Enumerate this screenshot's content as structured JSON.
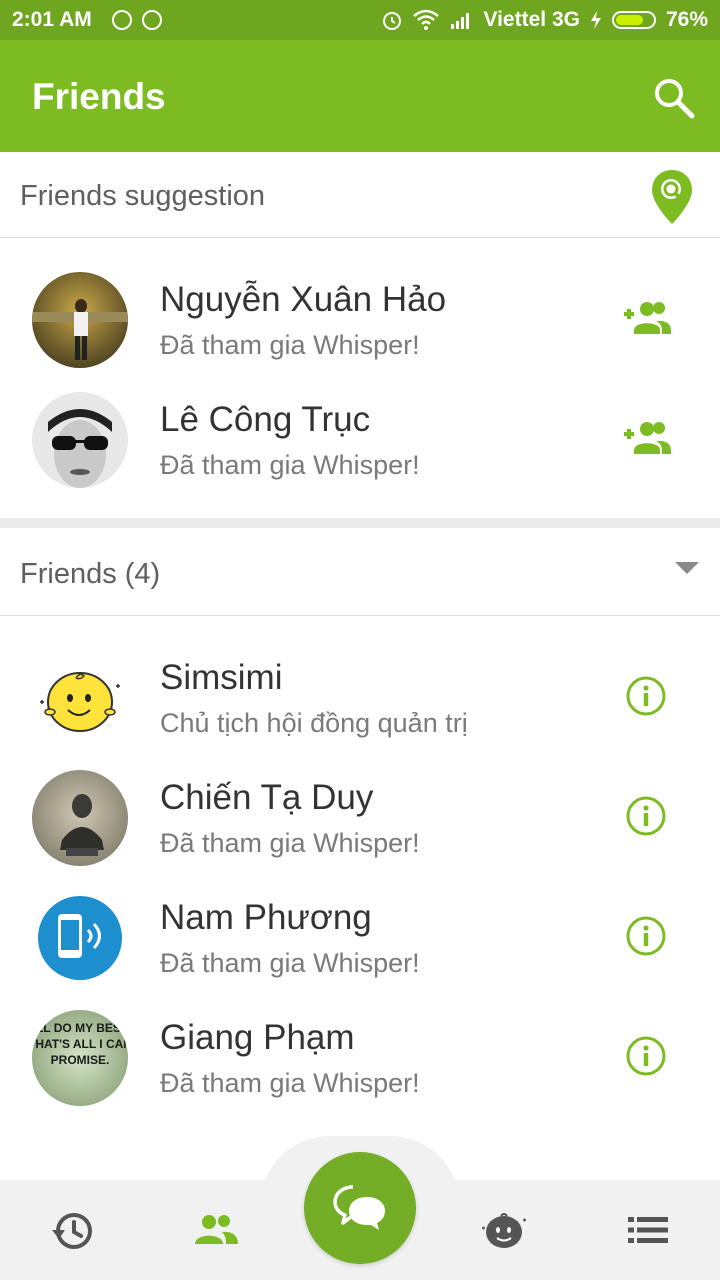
{
  "status_bar": {
    "time": "2:01 AM",
    "carrier": "Viettel 3G",
    "battery": "76%",
    "battery_level": 0.76
  },
  "app_bar": {
    "title": "Friends",
    "search_icon": "search-icon"
  },
  "suggestions": {
    "header": "Friends suggestion",
    "header_icon": "location-search-icon",
    "items": [
      {
        "name": "Nguyễn Xuân Hảo",
        "status": "Đã tham gia Whisper!",
        "action_icon": "add-friend-icon"
      },
      {
        "name": "Lê Công Trục",
        "status": "Đã tham gia Whisper!",
        "action_icon": "add-friend-icon"
      }
    ]
  },
  "friends": {
    "header": "Friends (4)",
    "header_icon": "caret-down-icon",
    "items": [
      {
        "name": "Simsimi",
        "status": "Chủ tịch hội đồng quản trị",
        "action_icon": "info-icon"
      },
      {
        "name": "Chiến Tạ Duy",
        "status": "Đã tham gia Whisper!",
        "action_icon": "info-icon"
      },
      {
        "name": "Nam Phương",
        "status": "Đã tham gia Whisper!",
        "action_icon": "info-icon"
      },
      {
        "name": "Giang Phạm",
        "status": "Đã tham gia Whisper!",
        "action_icon": "info-icon",
        "avatar_text": "I'LL DO MY BEST, THAT'S ALL I CAN PROMISE."
      }
    ]
  },
  "bottom_nav": {
    "items": [
      "history-icon",
      "friends-icon",
      "chat-icon",
      "simsimi-icon",
      "menu-icon"
    ],
    "active": "friends-icon"
  },
  "colors": {
    "primary": "#7dbb22",
    "status_bar": "#6ea71f",
    "accent": "#74ad26",
    "text_primary": "#333333",
    "text_secondary": "#7a7a7a"
  }
}
